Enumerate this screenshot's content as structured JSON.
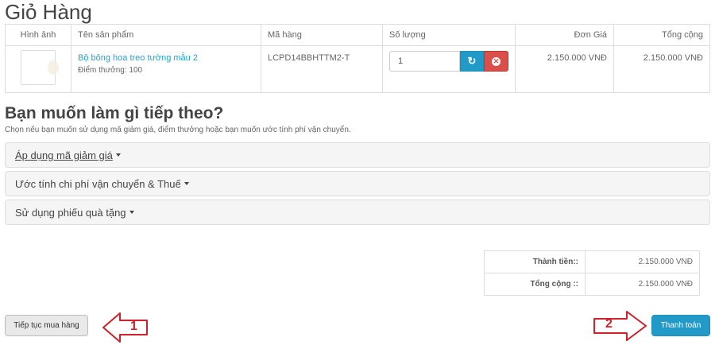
{
  "page": {
    "title": "Giỏ Hàng"
  },
  "cart": {
    "headers": {
      "image": "Hình ảnh",
      "name": "Tên sản phẩm",
      "code": "Mã hàng",
      "qty": "Số lượng",
      "unit_price": "Đơn Giá",
      "total": "Tổng cộng"
    },
    "rows": [
      {
        "name": "Bộ bông hoa treo tường mẫu 2",
        "reward": "Điểm thưởng: 100",
        "code": "LCPD14BBHTTM2-T",
        "qty": "1",
        "unit_price": "2.150.000 VNĐ",
        "total": "2.150.000 VNĐ"
      }
    ]
  },
  "next": {
    "title": "Bạn muốn làm gì tiếp theo?",
    "description": "Chọn nếu bạn muốn sử dụng mã giảm giá, điểm thưởng hoặc bạn muốn ước tính phí vận chuyển.",
    "panels": [
      {
        "label": "Áp dụng mã giảm giá"
      },
      {
        "label": "Ước tính chi phí vận chuyển & Thuế"
      },
      {
        "label": "Sử dụng phiếu quà tặng"
      }
    ]
  },
  "totals": [
    {
      "label": "Thành tiền::",
      "value": "2.150.000 VNĐ"
    },
    {
      "label": "Tổng cộng ::",
      "value": "2.150.000 VNĐ"
    }
  ],
  "buttons": {
    "continue": "Tiếp tục mua hàng",
    "checkout": "Thanh toán"
  },
  "annotations": {
    "arrow1_number": "1",
    "arrow2_number": "2",
    "color": "#d0202a"
  },
  "icons": {
    "refresh": "refresh-icon",
    "remove": "remove-icon",
    "caret": "caret-down-icon"
  },
  "colors": {
    "accent": "#229ac8",
    "danger": "#da4f49",
    "link": "#23a1d1"
  }
}
